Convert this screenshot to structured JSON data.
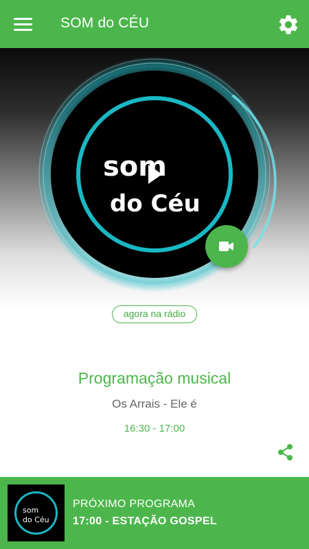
{
  "appbar": {
    "title": "SOM do CÉU",
    "menu_icon": "hamburger-menu-icon",
    "settings_icon": "gear-icon"
  },
  "player": {
    "logo_line1": "som",
    "logo_line2": "do Céu",
    "play_icon": "play-icon",
    "video_icon": "video-camera-icon"
  },
  "now": {
    "label": "agora na rádio",
    "program_title": "Programação musical",
    "track": "Os Arrais - Ele é",
    "time": "16:30 - 17:00",
    "share_icon": "share-icon"
  },
  "next": {
    "logo_line1": "som",
    "logo_line2": "do Céu",
    "label": "PRÓXIMO PROGRAMA",
    "program": "17:00 - ESTAÇÃO GOSPEL"
  },
  "colors": {
    "accent": "#4cb64c",
    "ring": "#19b8c4",
    "dark": "#000000"
  }
}
